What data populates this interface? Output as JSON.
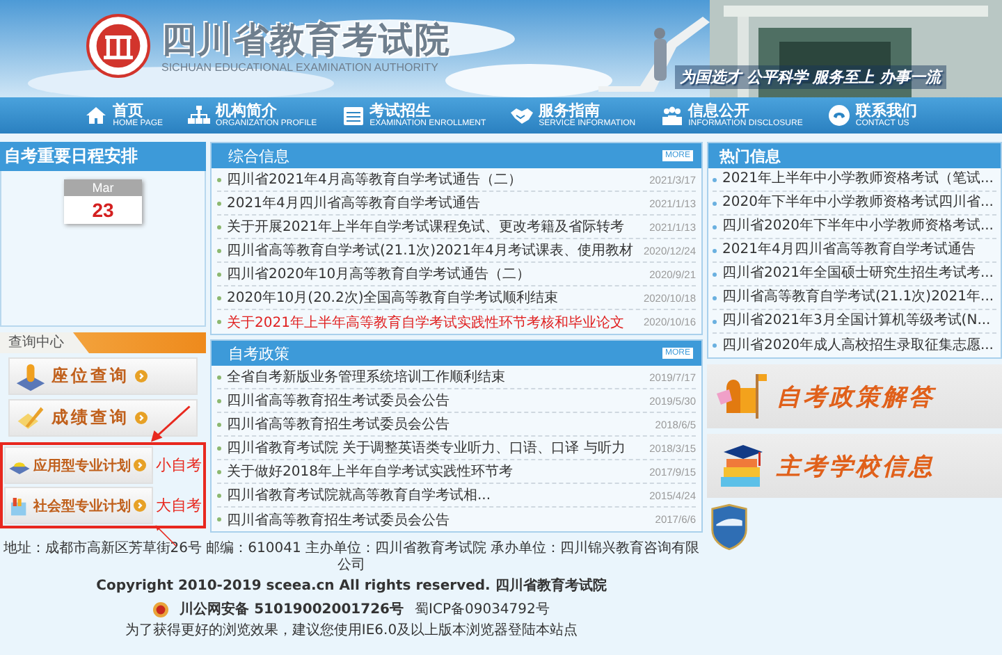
{
  "header": {
    "title": "四川省教育考试院",
    "subtitle": "SICHUAN EDUCATIONAL EXAMINATION AUTHORITY",
    "slogan": "为国选才 公平科学 服务至上 办事一流"
  },
  "nav": [
    {
      "label": "首页",
      "sublabel": "HOME PAGE"
    },
    {
      "label": "机构简介",
      "sublabel": "ORGANIZATION PROFILE"
    },
    {
      "label": "考试招生",
      "sublabel": "EXAMINATION ENROLLMENT"
    },
    {
      "label": "服务指南",
      "sublabel": "SERVICE INFORMATION"
    },
    {
      "label": "信息公开",
      "sublabel": "INFORMATION DISCLOSURE"
    },
    {
      "label": "联系我们",
      "sublabel": "CONTACT US"
    }
  ],
  "schedule": {
    "title": "自考重要日程安排",
    "month": "Mar",
    "day": "23"
  },
  "query_center": {
    "title": "查询中心",
    "items": [
      {
        "label": "座位查询"
      },
      {
        "label": "成绩查询"
      },
      {
        "label": "应用型专业计划",
        "note": "小自考"
      },
      {
        "label": "社会型专业计划",
        "note": "大自考"
      }
    ]
  },
  "general_news": {
    "title": "综合信息",
    "more": "MORE",
    "rows": [
      {
        "title": "四川省2021年4月高等教育自学考试通告（二）",
        "date": "2021/3/17",
        "highlight": false
      },
      {
        "title": "2021年4月四川省高等教育自学考试通告",
        "date": "2021/1/13",
        "highlight": false
      },
      {
        "title": "关于开展2021年上半年自学考试课程免试、更改考籍及省际转考",
        "date": "2021/1/13",
        "highlight": false
      },
      {
        "title": "四川省高等教育自学考试(21.1次)2021年4月考试课表、使用教材",
        "date": "2020/12/24",
        "highlight": false
      },
      {
        "title": "四川省2020年10月高等教育自学考试通告（二）",
        "date": "2020/9/21",
        "highlight": false
      },
      {
        "title": "2020年10月(20.2次)全国高等教育自学考试顺利结束",
        "date": "2020/10/18",
        "highlight": false
      },
      {
        "title": "关于2021年上半年高等教育自学考试实践性环节考核和毕业论文",
        "date": "2020/10/16",
        "highlight": true
      }
    ]
  },
  "policy_news": {
    "title": "自考政策",
    "more": "MORE",
    "rows": [
      {
        "title": "全省自考新版业务管理系统培训工作顺利结束",
        "date": "2019/7/17",
        "highlight": false
      },
      {
        "title": "四川省高等教育招生考试委员会公告",
        "date": "2019/5/30",
        "highlight": false
      },
      {
        "title": "四川省高等教育招生考试委员会公告",
        "date": "2018/6/5",
        "highlight": false
      },
      {
        "title": "四川省教育考试院 关于调整英语类专业听力、口语、口译 与听力",
        "date": "2018/3/15",
        "highlight": false
      },
      {
        "title": "关于做好2018年上半年自学考试实践性环节考",
        "date": "2017/9/15",
        "highlight": false
      },
      {
        "title": "四川省教育考试院就高等教育自学考试相...",
        "date": "2015/4/24",
        "highlight": false
      },
      {
        "title": "四川省高等教育招生考试委员会公告",
        "date": "2017/6/6",
        "highlight": false
      }
    ]
  },
  "hot_news": {
    "title": "热门信息",
    "items": [
      "2021年上半年中小学教师资格考试（笔试...",
      "2020年下半年中小学教师资格考试四川省...",
      "四川省2020年下半年中小学教师资格考试...",
      "2021年4月四川省高等教育自学考试通告",
      "四川省2021年全国硕士研究生招生考试考...",
      "四川省高等教育自学考试(21.1次)2021年...",
      "四川省2021年3月全国计算机等级考试(N...",
      "四川省2020年成人高校招生录取征集志愿..."
    ]
  },
  "banners": [
    {
      "label": "自考政策解答"
    },
    {
      "label": "主考学校信息"
    }
  ],
  "footer": {
    "address": "地址：成都市高新区芳草街26号 邮编：610041 主办单位：四川省教育考试院 承办单位：四川锦兴教育咨询有限公司",
    "copyright": "Copyright 2010-2019 sceea.cn All rights reserved. 四川省教育考试院",
    "police_record": "川公网安备 51019002001726号",
    "icp_record": "蜀ICP备09034792号",
    "notice": "为了获得更好的浏览效果，建议您使用IE6.0及以上版本浏览器登陆本站点"
  }
}
